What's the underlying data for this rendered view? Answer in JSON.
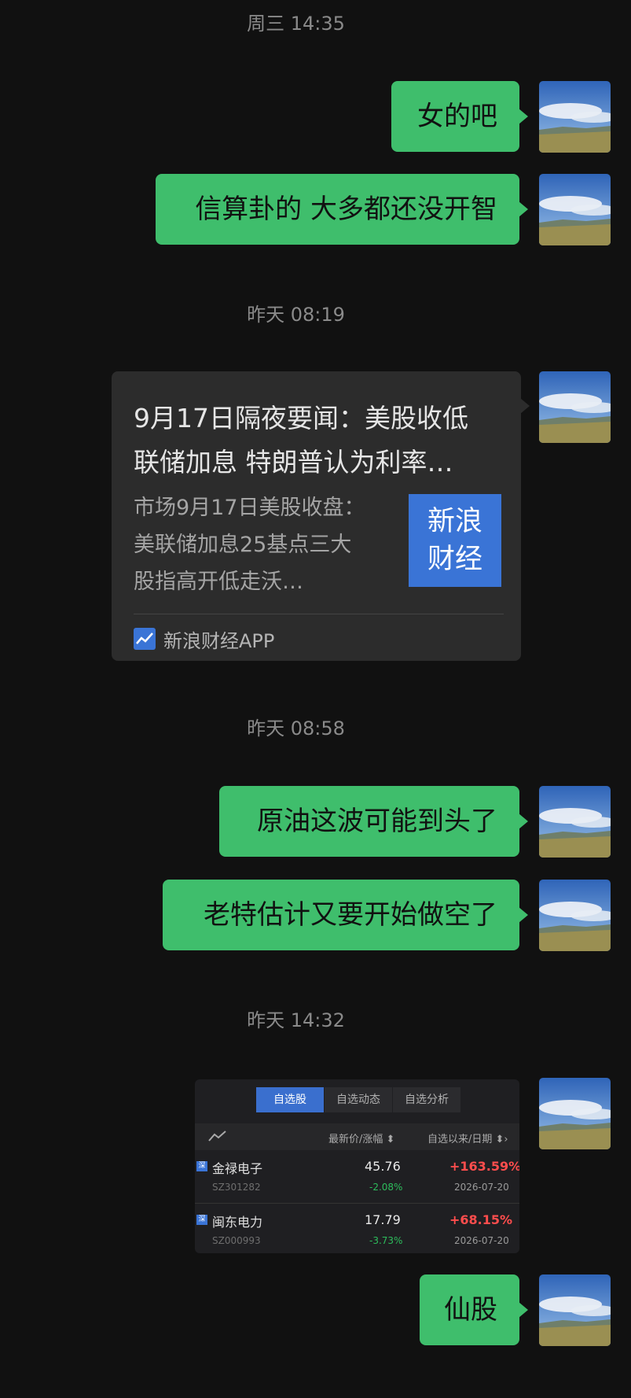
{
  "timestamps": [
    "周三 14:35",
    "昨天 08:19",
    "昨天 08:58",
    "昨天 14:32"
  ],
  "messages": {
    "m1": "女的吧",
    "m2": "信算卦的 大多都还没开智",
    "m3": "原油这波可能到头了",
    "m4": "老特估计又要开始做空了",
    "m5": "仙股"
  },
  "news_card": {
    "title_line1": "9月17日隔夜要闻：美股收低",
    "title_line2": "联储加息 特朗普认为利率…",
    "desc_line1": "市场9月17日美股收盘：",
    "desc_line2": "美联储加息25基点三大",
    "desc_line3": "股指高开低走沃…",
    "thumb_line1": "新浪",
    "thumb_line2": "财经",
    "source": "新浪财经APP"
  },
  "stock_shot": {
    "tabs": [
      "自选股",
      "自选动态",
      "自选分析"
    ],
    "header": {
      "price_col": "最新价/涨幅 ⬍",
      "since_col": "自选以来/日期 ⬍›"
    },
    "rows": [
      {
        "badge": "深",
        "name": "金禄电子",
        "code": "SZ301282",
        "price": "45.76",
        "change": "-2.08%",
        "gain": "+163.59%",
        "date": "2026-07-20"
      },
      {
        "badge": "深",
        "name": "闽东电力",
        "code": "SZ000993",
        "price": "17.79",
        "change": "-3.73%",
        "gain": "+68.15%",
        "date": "2026-07-20"
      }
    ]
  },
  "colors": {
    "bubble": "#3fbe6c",
    "background": "#111111",
    "card": "#2c2c2c",
    "brand_blue": "#3a74d6"
  },
  "icons": {
    "avatar": "landscape-avatar",
    "chart": "line-chart-icon"
  }
}
